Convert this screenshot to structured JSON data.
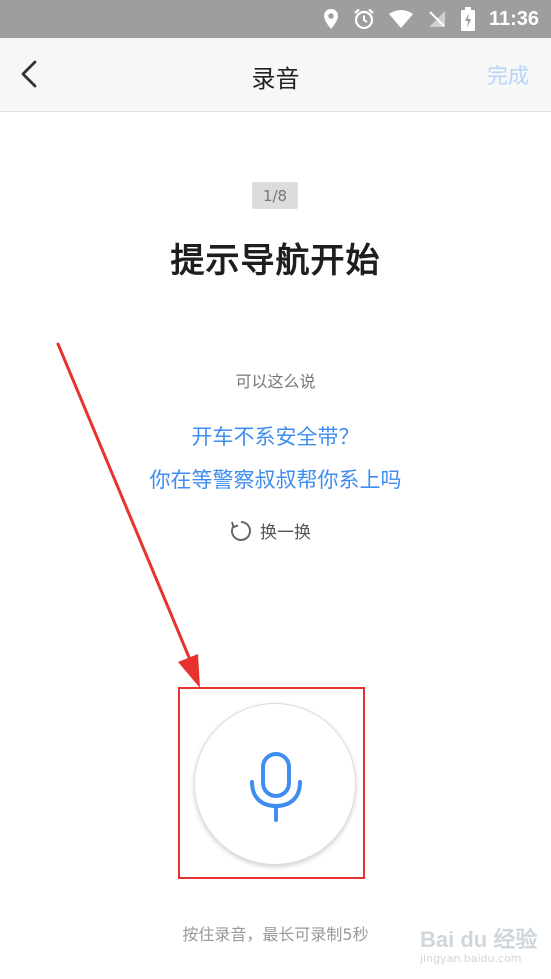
{
  "status_bar": {
    "time": "11:36",
    "icons": [
      "location-icon",
      "alarm-icon",
      "wifi-icon",
      "no-sim-icon",
      "battery-charging-icon"
    ]
  },
  "nav": {
    "back_icon": "chevron-left-icon",
    "title": "录音",
    "done_label": "完成"
  },
  "prompt": {
    "progress": "1/8",
    "title": "提示导航开始",
    "hint": "可以这么说",
    "samples": [
      "开车不系安全带？",
      "你在等警察叔叔帮你系上吗"
    ],
    "refresh_label": "换一换"
  },
  "recorder": {
    "mic_icon": "microphone-icon",
    "hint": "按住录音，最长可录制5秒"
  },
  "watermark": {
    "logo": "Bai du 经验",
    "url": "jingyan.baidu.com"
  },
  "colors": {
    "accent": "#3f8df0",
    "done_disabled": "#b6d4f7",
    "annotation_red": "#e8322e",
    "status_bar": "#9e9e9e"
  }
}
